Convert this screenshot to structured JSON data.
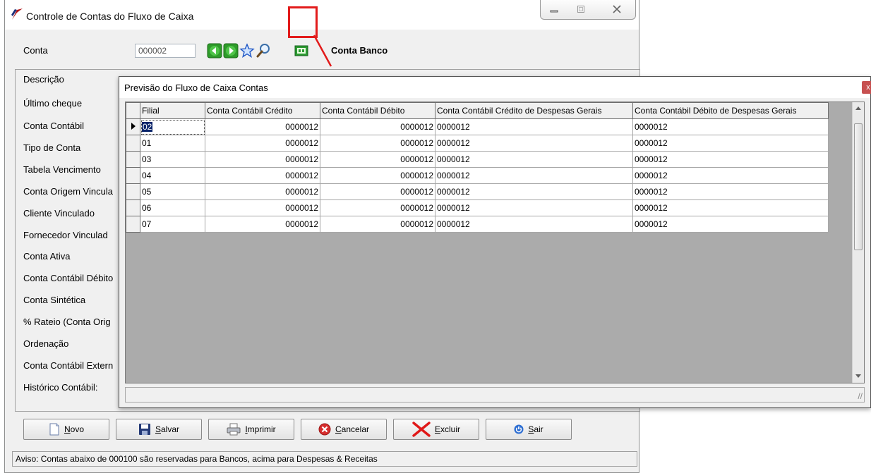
{
  "main_window": {
    "title": "Controle de Contas do Fluxo de Caixa",
    "controls": {
      "minimize": "▭",
      "maximize": "□",
      "close": "✕"
    }
  },
  "header": {
    "conta_label": "Conta",
    "conta_value": "000002",
    "conta_name": "Conta Banco"
  },
  "fields": [
    "Descrição",
    "Último cheque",
    "Conta Contábil",
    "Tipo de Conta",
    "Tabela Vencimento",
    "Conta Origem Vincula",
    "Cliente Vinculado",
    "Fornecedor Vinculad",
    "Conta Ativa",
    "Conta Contábil Débito",
    "Conta Sintética",
    "% Rateio (Conta Orig",
    "Ordenação",
    "Conta Contábil Extern",
    "Histórico Contábil:"
  ],
  "toolbar": {
    "novo": "Novo",
    "salvar": "Salvar",
    "imprimir": "Imprimir",
    "cancelar": "Cancelar",
    "excluir": "Excluir",
    "sair": "Sair"
  },
  "status": "Aviso: Contas abaixo de 000100 são reservadas para Bancos, acima para Despesas & Receitas",
  "popup": {
    "title": "Previsão do Fluxo de Caixa  Contas",
    "close": "x",
    "columns": [
      "Filial",
      "Conta Contábil Crédito",
      "Conta Contábil Débito",
      "Conta Contábil Crédito de Despesas Gerais",
      "Conta Contábil Débito de Despesas Gerais"
    ],
    "rows": [
      [
        "02",
        "0000012",
        "0000012",
        "0000012",
        "0000012"
      ],
      [
        "01",
        "0000012",
        "0000012",
        "0000012",
        "0000012"
      ],
      [
        "03",
        "0000012",
        "0000012",
        "0000012",
        "0000012"
      ],
      [
        "04",
        "0000012",
        "0000012",
        "0000012",
        "0000012"
      ],
      [
        "05",
        "0000012",
        "0000012",
        "0000012",
        "0000012"
      ],
      [
        "06",
        "0000012",
        "0000012",
        "0000012",
        "0000012"
      ],
      [
        "07",
        "0000012",
        "0000012",
        "0000012",
        "0000012"
      ]
    ],
    "grip": "//"
  },
  "colors": {
    "highlight": "#e21b1b",
    "selection": "#0a246a"
  }
}
